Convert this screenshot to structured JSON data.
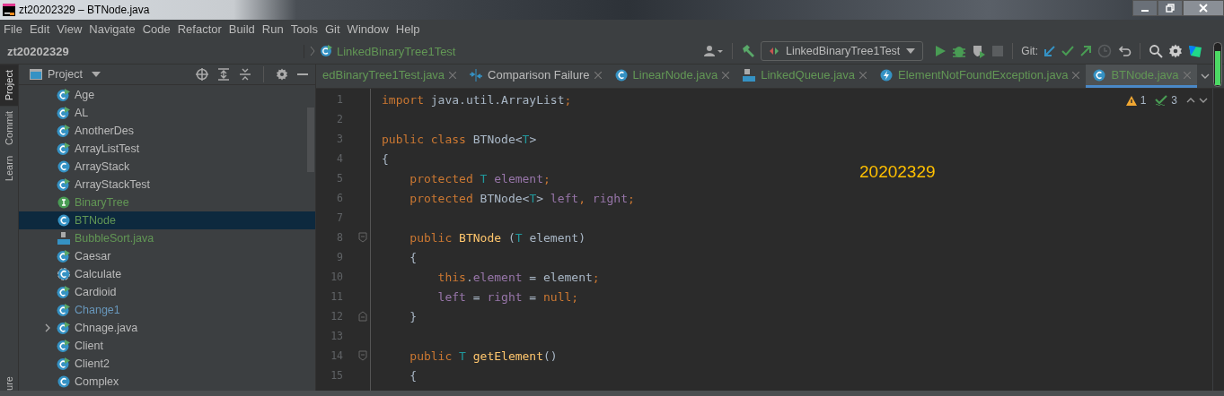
{
  "window": {
    "title": "zt20202329 – BTNode.java"
  },
  "menu": [
    "File",
    "Edit",
    "View",
    "Navigate",
    "Code",
    "Refactor",
    "Build",
    "Run",
    "Tools",
    "Git",
    "Window",
    "Help"
  ],
  "breadcrumb": [
    {
      "label": "zt20202329",
      "kind": "project"
    },
    {
      "label": "LinkedBinaryTree1Test",
      "kind": "test-class"
    }
  ],
  "run_config": {
    "label": "LinkedBinaryTree1Test"
  },
  "git_label": "Git:",
  "side_stripe": [
    {
      "label": "Project",
      "selected": true
    },
    {
      "label": "Commit",
      "selected": false
    },
    {
      "label": "Learn",
      "selected": false
    }
  ],
  "side_stripe_bottom": "ure",
  "project_panel": {
    "title": "Project",
    "items": [
      {
        "name": "Age",
        "kind": "test-class",
        "color": "#bbbbbb",
        "selected": false
      },
      {
        "name": "AL",
        "kind": "test-class",
        "color": "#bbbbbb",
        "selected": false
      },
      {
        "name": "AnotherDes",
        "kind": "test-class",
        "color": "#bbbbbb",
        "selected": false
      },
      {
        "name": "ArrayListTest",
        "kind": "test-class",
        "color": "#bbbbbb",
        "selected": false
      },
      {
        "name": "ArrayStack",
        "kind": "class",
        "color": "#bbbbbb",
        "selected": false
      },
      {
        "name": "ArrayStackTest",
        "kind": "test-class",
        "color": "#bbbbbb",
        "selected": false
      },
      {
        "name": "BinaryTree",
        "kind": "interface",
        "color": "#629755",
        "selected": false
      },
      {
        "name": "BTNode",
        "kind": "class",
        "color": "#629755",
        "selected": true
      },
      {
        "name": "BubbleSort.java",
        "kind": "java-file",
        "color": "#629755",
        "selected": false
      },
      {
        "name": "Caesar",
        "kind": "test-class",
        "color": "#bbbbbb",
        "selected": false
      },
      {
        "name": "Calculate",
        "kind": "abstract-class",
        "color": "#bbbbbb",
        "selected": false
      },
      {
        "name": "Cardioid",
        "kind": "test-class",
        "color": "#bbbbbb",
        "selected": false
      },
      {
        "name": "Change1",
        "kind": "test-class",
        "color": "#6897bb",
        "selected": false
      },
      {
        "name": "Chnage.java",
        "kind": "test-class",
        "color": "#bbbbbb",
        "selected": false,
        "expandable": true
      },
      {
        "name": "Client",
        "kind": "test-class",
        "color": "#bbbbbb",
        "selected": false
      },
      {
        "name": "Client2",
        "kind": "test-class",
        "color": "#bbbbbb",
        "selected": false
      },
      {
        "name": "Complex",
        "kind": "class",
        "color": "#bbbbbb",
        "selected": false
      }
    ]
  },
  "tabs": [
    {
      "label": "edBinaryTree1Test.java",
      "kind": "none",
      "color": "#629755",
      "selected": false
    },
    {
      "label": "Comparison Failure",
      "kind": "diff",
      "color": "#bbbbbb",
      "selected": false
    },
    {
      "label": "LinearNode.java",
      "kind": "class",
      "color": "#629755",
      "selected": false
    },
    {
      "label": "LinkedQueue.java",
      "kind": "java-file",
      "color": "#629755",
      "selected": false
    },
    {
      "label": "ElementNotFoundException.java",
      "kind": "exception",
      "color": "#629755",
      "selected": false
    },
    {
      "label": "BTNode.java",
      "kind": "class",
      "color": "#629755",
      "selected": true
    }
  ],
  "inspections": {
    "warnings": "1",
    "typos": "3"
  },
  "overlay_text": "20202329",
  "code": [
    {
      "number": "1",
      "kind": "code",
      "tokens": [
        {
          "t": "import ",
          "kind": "keyword"
        },
        {
          "t": "java.util.ArrayList",
          "kind": "plain"
        },
        {
          "t": ";",
          "kind": "keyword"
        }
      ]
    },
    {
      "number": "2",
      "kind": "code"
    },
    {
      "number": "3",
      "kind": "code",
      "tokens": [
        {
          "t": "public class ",
          "kind": "keyword"
        },
        {
          "t": "BTNode<",
          "kind": "plain"
        },
        {
          "t": "T",
          "kind": "typeparam"
        },
        {
          "t": ">",
          "kind": "plain"
        }
      ]
    },
    {
      "number": "4",
      "kind": "code",
      "tokens": [
        {
          "t": "{",
          "kind": "plain"
        }
      ]
    },
    {
      "number": "5",
      "kind": "code",
      "tokens": [
        {
          "t": "    protected ",
          "kind": "keyword"
        },
        {
          "t": "T ",
          "kind": "typeparam"
        },
        {
          "t": "element",
          "kind": "field"
        },
        {
          "t": ";",
          "kind": "keyword"
        }
      ]
    },
    {
      "number": "6",
      "kind": "code",
      "tokens": [
        {
          "t": "    protected ",
          "kind": "keyword"
        },
        {
          "t": "BTNode<",
          "kind": "plain"
        },
        {
          "t": "T",
          "kind": "typeparam"
        },
        {
          "t": "> ",
          "kind": "plain"
        },
        {
          "t": "left",
          "kind": "field"
        },
        {
          "t": ", ",
          "kind": "keyword"
        },
        {
          "t": "right",
          "kind": "field"
        },
        {
          "t": ";",
          "kind": "keyword"
        }
      ]
    },
    {
      "number": "7",
      "kind": "code"
    },
    {
      "number": "8",
      "kind": "fold-start",
      "tokens": [
        {
          "t": "    public ",
          "kind": "keyword"
        },
        {
          "t": "BTNode ",
          "kind": "method"
        },
        {
          "t": "(",
          "kind": "plain"
        },
        {
          "t": "T ",
          "kind": "typeparam"
        },
        {
          "t": "element)",
          "kind": "plain"
        }
      ]
    },
    {
      "number": "9",
      "kind": "code",
      "tokens": [
        {
          "t": "    {",
          "kind": "plain"
        }
      ]
    },
    {
      "number": "10",
      "kind": "code",
      "tokens": [
        {
          "t": "        this",
          "kind": "keyword"
        },
        {
          "t": ".",
          "kind": "plain"
        },
        {
          "t": "element",
          "kind": "field"
        },
        {
          "t": " = element",
          "kind": "plain"
        },
        {
          "t": ";",
          "kind": "keyword"
        }
      ]
    },
    {
      "number": "11",
      "kind": "code",
      "tokens": [
        {
          "t": "        left",
          "kind": "field"
        },
        {
          "t": " = ",
          "kind": "plain"
        },
        {
          "t": "right",
          "kind": "field"
        },
        {
          "t": " = ",
          "kind": "plain"
        },
        {
          "t": "null;",
          "kind": "keyword"
        }
      ]
    },
    {
      "number": "12",
      "kind": "fold-end",
      "tokens": [
        {
          "t": "    }",
          "kind": "plain"
        }
      ]
    },
    {
      "number": "13",
      "kind": "code"
    },
    {
      "number": "14",
      "kind": "fold-start",
      "tokens": [
        {
          "t": "    public ",
          "kind": "keyword"
        },
        {
          "t": "T ",
          "kind": "typeparam"
        },
        {
          "t": "getElement",
          "kind": "method"
        },
        {
          "t": "()",
          "kind": "plain"
        }
      ]
    },
    {
      "number": "15",
      "kind": "code",
      "tokens": [
        {
          "t": "    {",
          "kind": "plain"
        }
      ]
    }
  ]
}
